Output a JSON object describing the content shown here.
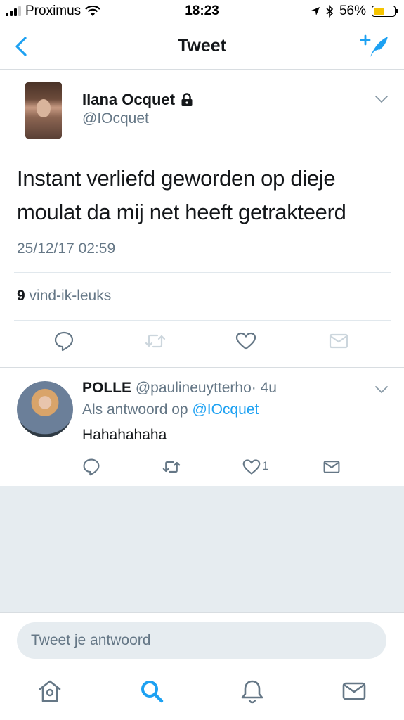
{
  "status_bar": {
    "carrier": "Proximus",
    "time": "18:23",
    "battery_percent": "56%",
    "battery_level": 0.56,
    "signal_bars": 3,
    "battery_color": "#f5c400"
  },
  "nav": {
    "title": "Tweet",
    "back_icon": "chevron-left-icon",
    "compose_icon": "compose-tweet-icon",
    "accent_color": "#1da1f2"
  },
  "tweet": {
    "author_name": "Ilana Ocquet",
    "author_handle": "@IOcquet",
    "protected": true,
    "text": "Instant verliefd geworden op dieje moulat da mij net heeft getrakteerd",
    "timestamp": "25/12/17 02:59",
    "likes_count": "9",
    "likes_label": "vind-ik-leuks"
  },
  "reply": {
    "author_name": "POLLE",
    "author_handle": "@paulineuytterho",
    "time_ago": "· 4u",
    "in_reply_prefix": "Als antwoord op",
    "in_reply_handle": "@IOcquet",
    "text": "Hahahahaha",
    "like_count": "1"
  },
  "composer": {
    "placeholder": "Tweet je antwoord"
  },
  "tab_bar": {
    "items": [
      "home-icon",
      "search-icon",
      "notifications-icon",
      "messages-icon"
    ],
    "active": "search-icon"
  }
}
